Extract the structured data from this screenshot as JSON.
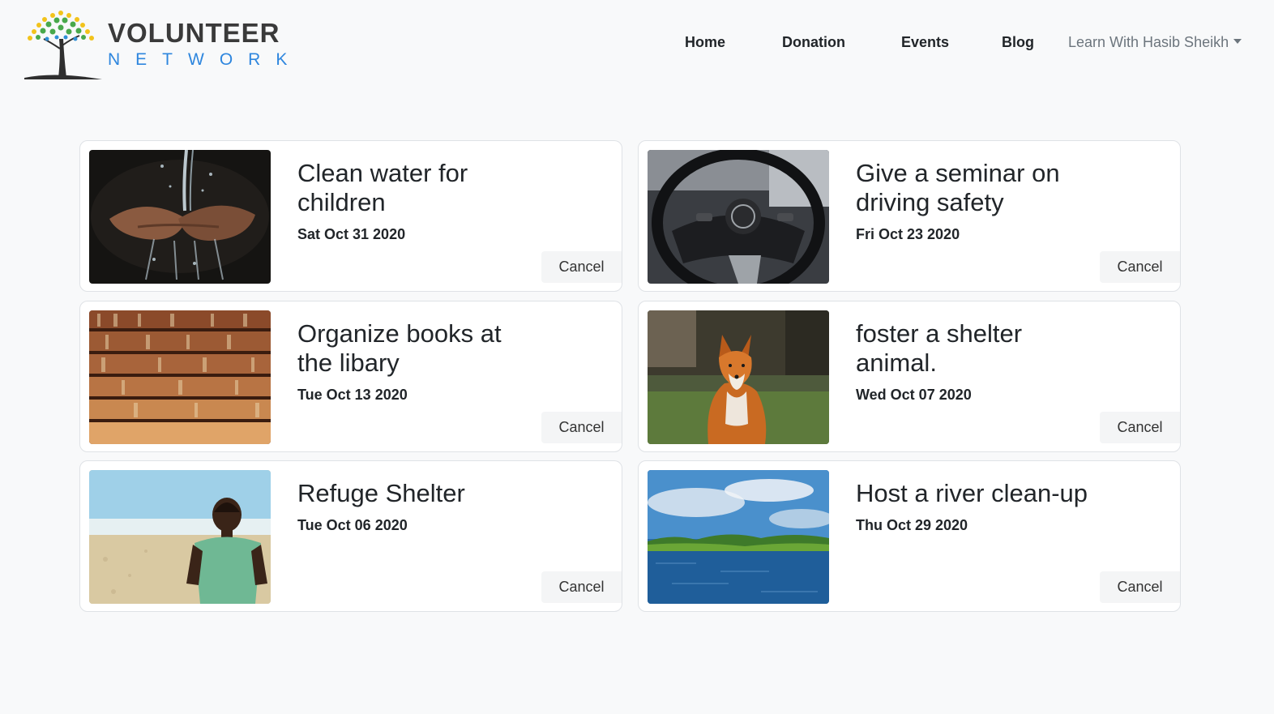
{
  "brand": {
    "title": "VOLUNTEER",
    "subtitle": "NETWORK",
    "colors": {
      "tree_leaves": "#f2c31b",
      "tree_leaves_green": "#48a84b",
      "tree_trunk": "#2f2f2f",
      "subtitle": "#2e86de"
    }
  },
  "nav": {
    "home": "Home",
    "donation": "Donation",
    "events": "Events",
    "blog": "Blog",
    "user": "Learn With Hasib Sheikh"
  },
  "events": [
    {
      "title": "Clean water for children",
      "date": "Sat Oct 31 2020",
      "cancel": "Cancel",
      "image": "hands-water-image"
    },
    {
      "title": "Give a seminar on driving safety",
      "date": "Fri Oct 23 2020",
      "cancel": "Cancel",
      "image": "steering-wheel-image"
    },
    {
      "title": "Organize books at the libary",
      "date": "Tue Oct 13 2020",
      "cancel": "Cancel",
      "image": "bookshelf-image"
    },
    {
      "title": "foster a shelter animal.",
      "date": "Wed Oct 07 2020",
      "cancel": "Cancel",
      "image": "fox-image"
    },
    {
      "title": "Refuge Shelter",
      "date": "Tue Oct 06 2020",
      "cancel": "Cancel",
      "image": "child-image"
    },
    {
      "title": "Host a river clean-up",
      "date": "Thu Oct 29 2020",
      "cancel": "Cancel",
      "image": "river-image"
    }
  ]
}
